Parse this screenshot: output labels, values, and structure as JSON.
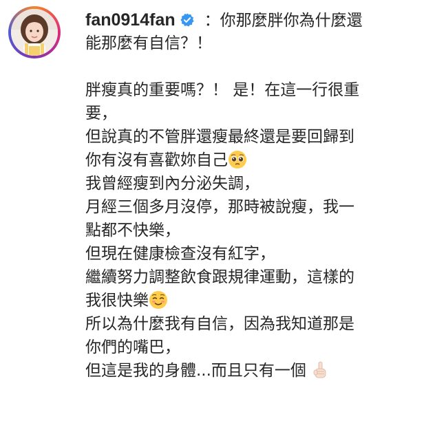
{
  "post": {
    "username": "fan0914fan",
    "caption_first": "：你那麼胖你為什麼還",
    "caption_lines": [
      "能那麼有自信？！",
      "",
      "胖瘦真的重要嗎？！ 是！在這一行很重",
      "要，",
      "但說真的不管胖還瘦最終還是要回歸到",
      "你有沒有喜歡妳自己",
      "我曾經瘦到內分泌失調，",
      "月經三個多月沒停，那時被說瘦，我一",
      "點都不快樂，",
      "但現在健康檢查沒有紅字，",
      "繼續努力調整飲食跟規律運動，這樣的",
      "我很快樂",
      "所以為什麼我有自信，因為我知道那是",
      "你們的嘴巴，",
      "但這是我的身體...而且只有一個"
    ],
    "emojis": {
      "pleading": "pleading-face-emoji",
      "smiling": "smiling-face-emoji",
      "index_up": "index-pointing-up-emoji"
    },
    "colors": {
      "text": "#262626",
      "verified": "#3897f0"
    }
  }
}
